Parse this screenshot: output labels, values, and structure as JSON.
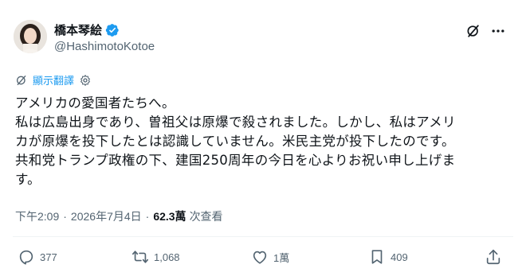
{
  "author": {
    "display_name": "橋本琴絵",
    "handle": "@HashimotoKotoe"
  },
  "translate": {
    "label": "顯示翻譯"
  },
  "tweet": {
    "lines": [
      "アメリカの愛国者たちへ。",
      "私は広島出身であり、曽祖父は原爆で殺されました。しかし、私はアメリ",
      "カが原爆を投下したとは認識していません。米民主党が投下したのです。",
      "共和党トランプ政権の下、建国250周年の今日を心よりお祝い申し上げま",
      "す。"
    ]
  },
  "meta": {
    "time": "下午2:09",
    "separator": "·",
    "date": "2026年7月4日",
    "views": "62.3萬",
    "views_label": "次查看"
  },
  "actions": {
    "replies": "377",
    "reposts": "1,068",
    "likes": "1萬",
    "bookmarks": "409"
  },
  "colors": {
    "accent": "#1d9bf0",
    "text": "#0f1419",
    "secondary": "#536471",
    "divider": "#eff3f4"
  },
  "icons": [
    "verified-badge-icon",
    "grok-icon",
    "more-icon",
    "translate-icon",
    "settings-icon",
    "reply-icon",
    "repost-icon",
    "like-icon",
    "bookmark-icon",
    "share-icon"
  ]
}
